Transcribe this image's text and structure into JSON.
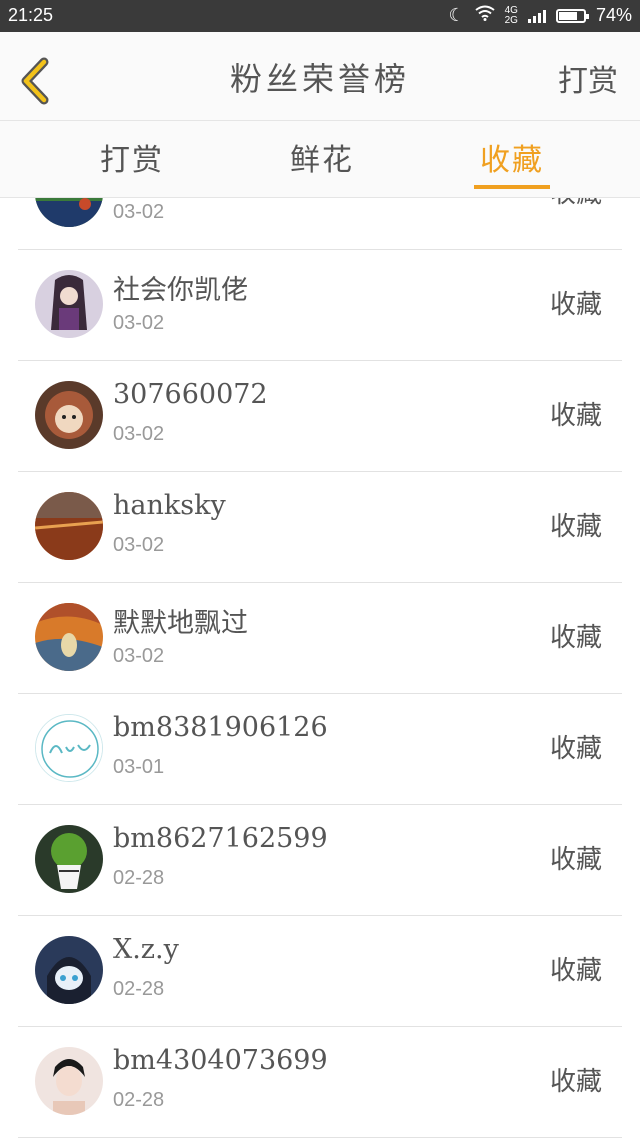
{
  "status_bar": {
    "time": "21:25",
    "network": [
      "4G",
      "2G"
    ],
    "battery_percent": "74%",
    "battery_level": 0.74
  },
  "nav": {
    "title": "粉丝荣誉榜",
    "action": "打赏",
    "back_icon": "chevron-left-icon",
    "accent_color": "#f0a020"
  },
  "tabs": [
    {
      "label": "打赏",
      "active": false
    },
    {
      "label": "鲜花",
      "active": false
    },
    {
      "label": "收藏",
      "active": true
    }
  ],
  "rows": [
    {
      "name": "",
      "date": "03-02",
      "action": "收藏"
    },
    {
      "name": "社会你凯佬",
      "date": "03-02",
      "action": "收藏"
    },
    {
      "name": "307660072",
      "date": "03-02",
      "action": "收藏"
    },
    {
      "name": "hanksky",
      "date": "03-02",
      "action": "收藏"
    },
    {
      "name": "默默地飘过",
      "date": "03-02",
      "action": "收藏"
    },
    {
      "name": "bm8381906126",
      "date": "03-01",
      "action": "收藏"
    },
    {
      "name": "bm8627162599",
      "date": "02-28",
      "action": "收藏"
    },
    {
      "name": "X.z.y",
      "date": "02-28",
      "action": "收藏"
    },
    {
      "name": "bm4304073699",
      "date": "02-28",
      "action": "收藏"
    }
  ]
}
